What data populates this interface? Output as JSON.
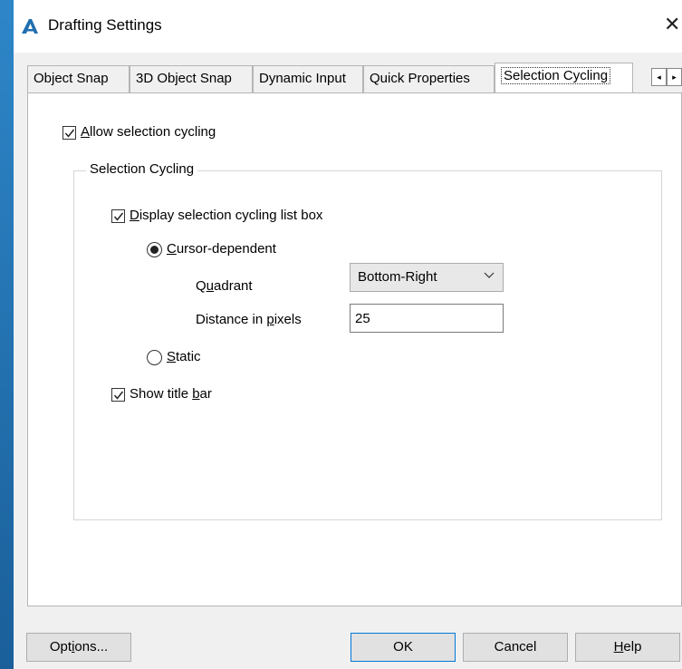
{
  "window": {
    "title": "Drafting Settings",
    "close_glyph": "✕"
  },
  "tabs": [
    {
      "label": "Object Snap"
    },
    {
      "label": "3D Object Snap"
    },
    {
      "label": "Dynamic Input"
    },
    {
      "label": "Quick Properties"
    },
    {
      "label": "Selection Cycling",
      "active": true
    }
  ],
  "tab_scroll": {
    "left": "◂",
    "right": "▸"
  },
  "allow_cycling": {
    "label_pre": "",
    "label_u": "A",
    "label_post": "llow selection cycling",
    "checked": true
  },
  "group": {
    "title": "Selection Cycling"
  },
  "display_listbox": {
    "label_pre": "",
    "label_u": "D",
    "label_post": "isplay selection cycling list box",
    "checked": true
  },
  "cursor_dependent": {
    "label_pre": "",
    "label_u": "C",
    "label_post": "ursor-dependent",
    "selected": true
  },
  "quadrant": {
    "label_pre": "Q",
    "label_u": "u",
    "label_post": "adrant",
    "value": "Bottom-Right"
  },
  "distance": {
    "label_pre": "Distance in ",
    "label_u": "p",
    "label_post": "ixels",
    "value": "25"
  },
  "static": {
    "label_pre": "",
    "label_u": "S",
    "label_post": "tatic",
    "selected": false
  },
  "show_title_bar": {
    "label_pre": "Show title ",
    "label_u": "b",
    "label_post": "ar",
    "checked": true
  },
  "buttons": {
    "options": {
      "pre": "Opt",
      "u": "i",
      "post": "ons..."
    },
    "ok": "OK",
    "cancel": "Cancel",
    "help": {
      "pre": "",
      "u": "H",
      "post": "elp"
    }
  },
  "colors": {
    "desktop": "#1f6fb0",
    "dialog": "#f0f0f0",
    "icon_accent": "#1f6fb0",
    "default_button_border": "#0078d7"
  }
}
